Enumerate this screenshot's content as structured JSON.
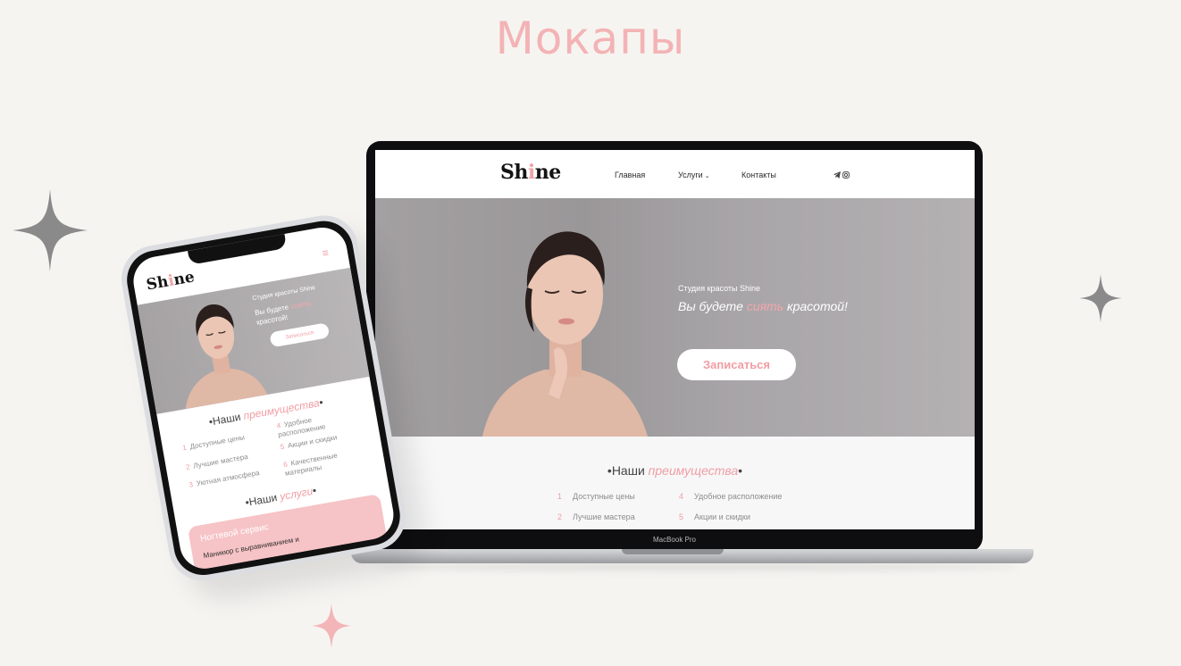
{
  "page": {
    "title": "Мокапы"
  },
  "colors": {
    "accent": "#f19da3",
    "background": "#f6f4f1",
    "sparkle_gray": "#8a8a8a",
    "sparkle_pink": "#f4b5b8"
  },
  "laptop": {
    "brand_label": "MacBook Pro",
    "site": {
      "logo": {
        "prefix": "Sh",
        "accent": "i",
        "suffix": "ne"
      },
      "nav": {
        "home": "Главная",
        "services": "Услуги",
        "services_caret": "⌄",
        "contacts": "Контакты"
      },
      "social_icons": [
        "telegram-icon",
        "instagram-icon"
      ],
      "hero": {
        "subtitle": "Студия красоты Shine",
        "title_before": "Вы будете ",
        "title_accent": "сиять",
        "title_after": " красотой!",
        "cta": "Записаться"
      },
      "advantages": {
        "title_prefix": "•Наши ",
        "title_accent": "преимущества",
        "title_suffix": "•",
        "items": [
          {
            "num": "1",
            "text": "Доступные цены"
          },
          {
            "num": "4",
            "text": "Удобное расположение"
          },
          {
            "num": "2",
            "text": "Лучшие мастера"
          },
          {
            "num": "5",
            "text": "Акции и скидки"
          }
        ]
      }
    }
  },
  "phone": {
    "logo": {
      "prefix": "Sh",
      "accent": "i",
      "suffix": "ne"
    },
    "menu_icon": "≡",
    "hero": {
      "subtitle": "Студия красоты Shine",
      "title_before": "Вы будете ",
      "title_accent": "сиять",
      "title_after": " красотой!",
      "cta": "Записаться"
    },
    "advantages": {
      "title_prefix": "•Наши ",
      "title_accent": "преимущества",
      "title_suffix": "•",
      "items": [
        {
          "num": "1",
          "text": "Доступные цены"
        },
        {
          "num": "4",
          "text": "Удобное расположение"
        },
        {
          "num": "2",
          "text": "Лучшие мастера"
        },
        {
          "num": "5",
          "text": "Акции и скидки"
        },
        {
          "num": "3",
          "text": "Уютная атмосфера"
        },
        {
          "num": "6",
          "text": "Качественные материалы"
        }
      ]
    },
    "services": {
      "title_prefix": "•Наши ",
      "title_accent": "услуги",
      "title_suffix": "•",
      "card_title": "Ногтевой сервис",
      "card_text": "Маникюр с выравниванием и"
    }
  }
}
